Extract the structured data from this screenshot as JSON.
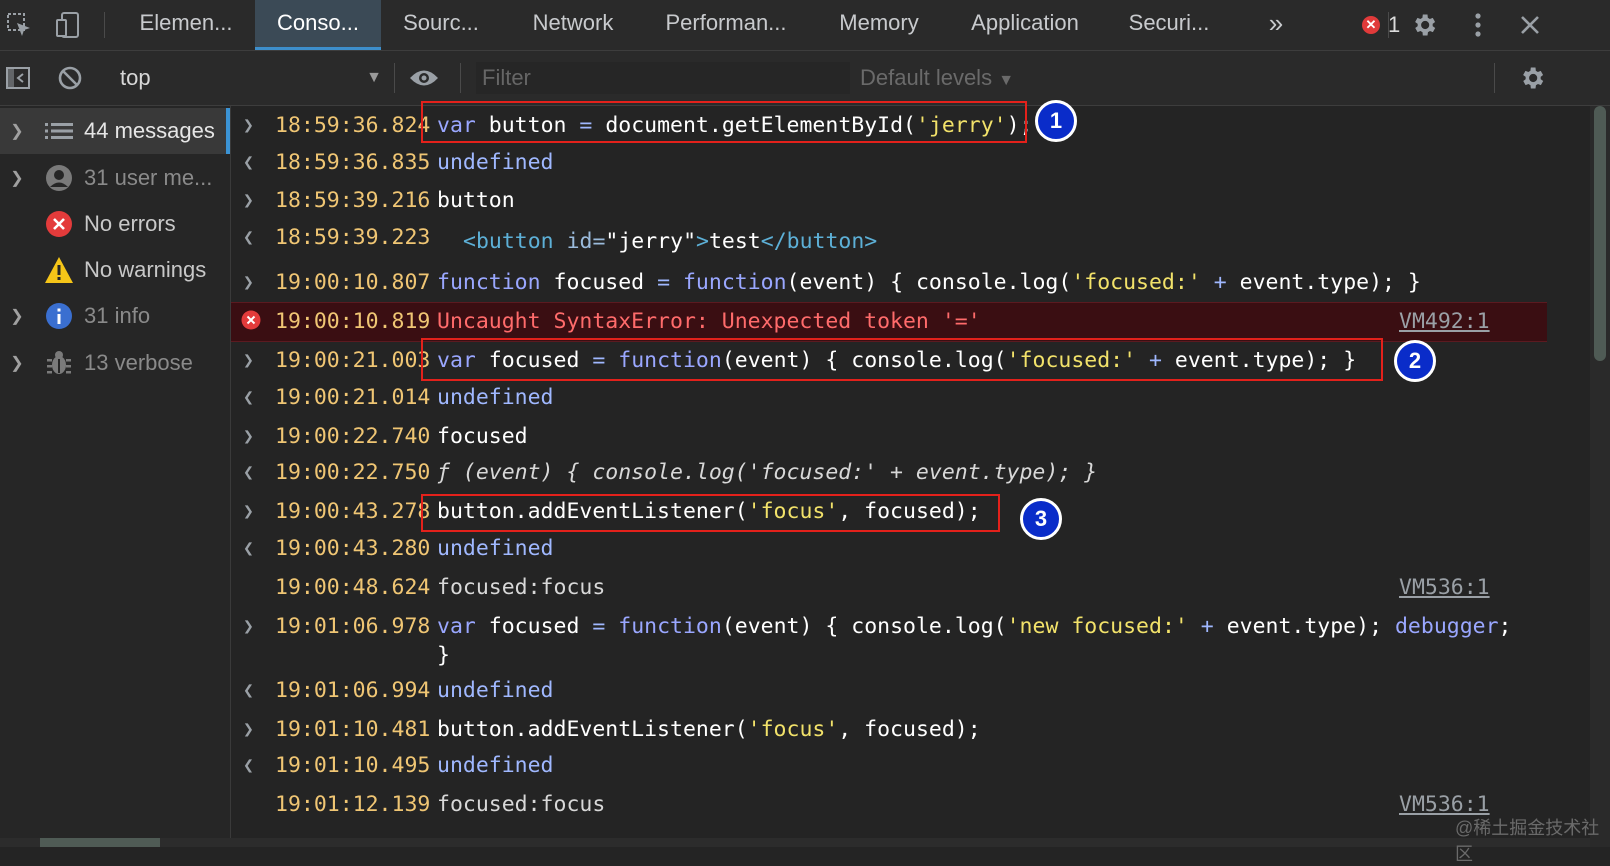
{
  "tabs": [
    {
      "label": "Elemen..."
    },
    {
      "label": "Conso..."
    },
    {
      "label": "Sourc..."
    },
    {
      "label": "Network"
    },
    {
      "label": "Performan..."
    },
    {
      "label": "Memory"
    },
    {
      "label": "Application"
    },
    {
      "label": "Securi..."
    }
  ],
  "tabbar": {
    "more_label": "»",
    "error_count": "1"
  },
  "toolbar": {
    "context": "top",
    "filter_placeholder": "Filter",
    "levels": "Default levels"
  },
  "sidebar": {
    "items": [
      {
        "label": "44 messages"
      },
      {
        "label": "31 user me..."
      },
      {
        "label": "No errors"
      },
      {
        "label": "No warnings"
      },
      {
        "label": "31 info"
      },
      {
        "label": "13 verbose"
      }
    ]
  },
  "console": {
    "rows": [
      {
        "ts": "18:59:36.824",
        "code": "var button = document.getElementById('jerry');"
      },
      {
        "ts": "18:59:36.835",
        "code": "undefined"
      },
      {
        "ts": "18:59:39.216",
        "code": "button"
      },
      {
        "ts": "18:59:39.223",
        "code": "<button id=\"jerry\">test</button>"
      },
      {
        "ts": "19:00:10.807",
        "code": "function focused = function(event) { console.log('focused:' + event.type); }"
      },
      {
        "ts": "19:00:10.819",
        "code": "Uncaught SyntaxError: Unexpected token '='",
        "link": "VM492:1"
      },
      {
        "ts": "19:00:21.003",
        "code": "var focused = function(event) { console.log('focused:' + event.type); }"
      },
      {
        "ts": "19:00:21.014",
        "code": "undefined"
      },
      {
        "ts": "19:00:22.740",
        "code": "focused"
      },
      {
        "ts": "19:00:22.750",
        "code": "ƒ (event) { console.log('focused:' + event.type); }"
      },
      {
        "ts": "19:00:43.278",
        "code": "button.addEventListener('focus', focused);"
      },
      {
        "ts": "19:00:43.280",
        "code": "undefined"
      },
      {
        "ts": "19:00:48.624",
        "code": "focused:focus",
        "link": "VM536:1"
      },
      {
        "ts": "19:01:06.978",
        "code": "var focused = function(event) { console.log('new focused:' + event.type); debugger;",
        "cont": "}"
      },
      {
        "ts": "19:01:06.994",
        "code": "undefined"
      },
      {
        "ts": "19:01:10.481",
        "code": "button.addEventListener('focus', focused);"
      },
      {
        "ts": "19:01:10.495",
        "code": "undefined"
      },
      {
        "ts": "19:01:12.139",
        "code": "focused:focus",
        "link": "VM536:1"
      }
    ]
  },
  "annotations": {
    "b1": "1",
    "b2": "2",
    "b3": "3"
  },
  "watermark": "@稀土掘金技术社区",
  "colors": {
    "accent": "#3d8fcc",
    "error_bg": "#3a0e12",
    "timestamp": "#f0c674",
    "string": "#f2e26a",
    "keyword": "#9aa7ff",
    "highlight_box": "#e3211b",
    "badge": "#0a2cc9"
  }
}
